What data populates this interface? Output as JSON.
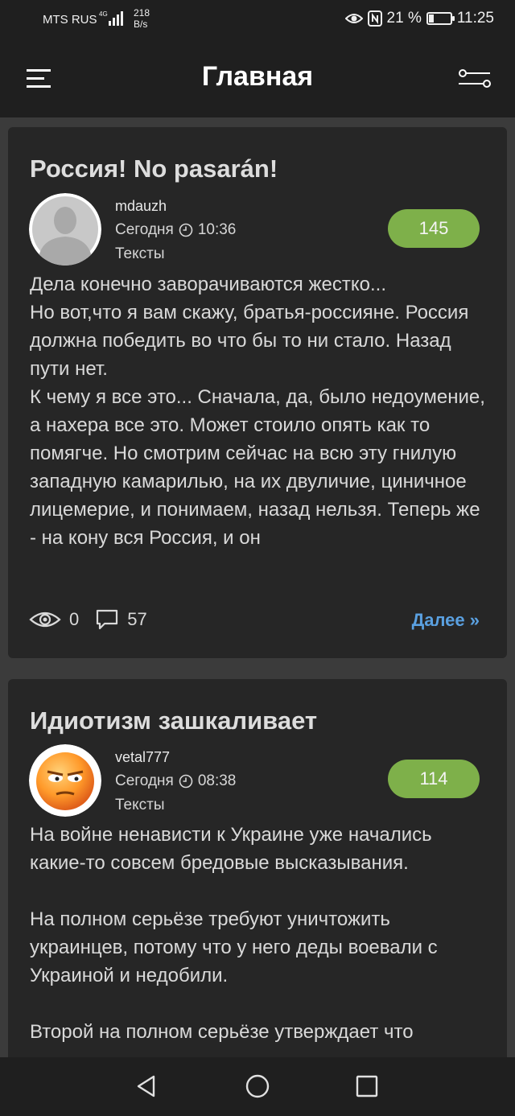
{
  "status_bar": {
    "carrier": "MTS RUS",
    "network": "4G",
    "speed_value": "218",
    "speed_unit": "B/s",
    "battery": "21 %",
    "battery_level": 0.21,
    "time": "11:25",
    "icons": [
      "signal-icon",
      "eye-comfort-icon",
      "nfc-icon",
      "battery-icon"
    ]
  },
  "header": {
    "title": "Главная",
    "menu_icon": "menu-icon",
    "filter_icon": "filter-icon"
  },
  "posts": [
    {
      "title": "Россия! No pasarán!",
      "author": "mdauzh",
      "date": "Сегодня",
      "time": "10:36",
      "category": "Тексты",
      "rating": "145",
      "avatar": "default-user-avatar",
      "body": "Дела конечно заворачиваются жестко...\nНо вот,что я вам скажу, братья-россияне. Россия должна победить во что бы то ни стало. Назад пути нет.\nК чему я все это... Сначала, да, было недоумение, а нахера все это. Может стоило опять как то помягче. Но смотрим сейчас на всю эту гнилую западную камарилью, на их двуличие, циничное лицемерие, и понимаем, назад нельзя. Теперь же - на кону вся Россия, и он",
      "views": "0",
      "comments": "57",
      "more": "Далее »"
    },
    {
      "title": "Идиотизм зашкаливает",
      "author": "vetal777",
      "date": "Сегодня",
      "time": "08:38",
      "category": "Тексты",
      "rating": "114",
      "avatar": "smiley-avatar",
      "body": "На войне ненависти к Украине уже начались какие-то совсем бредовые высказывания.\n\nНа полном серьёзе требуют уничтожить украинцев, потому что у него деды воевали с Украиной и недобили.\n\nВторой на полном серьёзе утверждает что"
    }
  ],
  "nav": {
    "back": "back-icon",
    "home": "home-icon",
    "recents": "recents-icon"
  },
  "colors": {
    "background": "#3b3b3b",
    "card": "#262626",
    "bars": "#1f1f1f",
    "rating_badge": "#7eb04a",
    "link": "#5aa0e0"
  }
}
